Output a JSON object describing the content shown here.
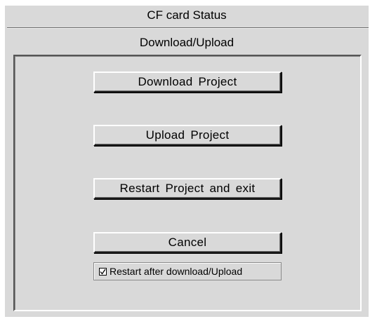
{
  "window": {
    "title": "CF card  Status",
    "subtitle": "Download/Upload"
  },
  "buttons": {
    "download": "Download  Project",
    "upload": "Upload  Project",
    "restart": "Restart  Project and  exit",
    "cancel": "Cancel"
  },
  "options": {
    "restart_after_label": "Restart after download/Upload",
    "restart_after_checked": true
  },
  "icons": {
    "check": "check-mark-icon"
  }
}
